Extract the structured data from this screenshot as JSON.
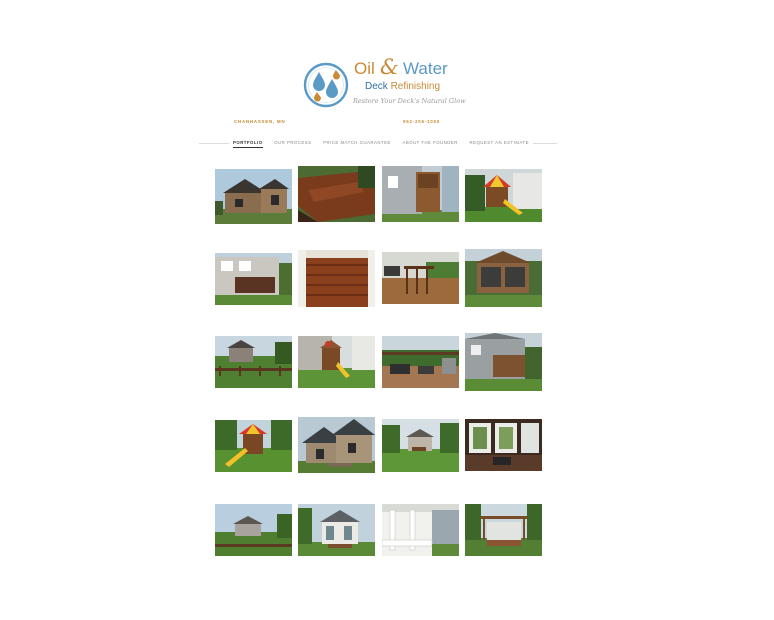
{
  "brand": {
    "oil": "Oil",
    "amp": "&",
    "water": "Water",
    "deck": "Deck",
    "refinishing": "Refinishing",
    "tagline": "Restore Your Deck's Natural Glow",
    "colors": {
      "gold": "#c98a35",
      "blue": "#5b9ac7",
      "dark_blue": "#2f6fa8"
    }
  },
  "header": {
    "location": "CHANHASSEN, MN",
    "phone": "952-206-1050"
  },
  "nav": {
    "items": [
      {
        "label": "PORTFOLIO",
        "active": true
      },
      {
        "label": "OUR PROCESS"
      },
      {
        "label": "PRICE MATCH GUARANTEE"
      },
      {
        "label": "ABOUT THE FOUNDER"
      },
      {
        "label": "REQUEST AN ESTIMATE"
      }
    ]
  },
  "gallery": {
    "rows": [
      [
        "house-exterior",
        "stained-deck",
        "deck-side-house",
        "playset"
      ],
      [
        "house-rear-deck",
        "deck-boards-closeup",
        "deck-railing-patio",
        "screened-porch"
      ],
      [
        "backyard-fence",
        "playset-yard",
        "patio-furniture",
        "deck-grey-house"
      ],
      [
        "playset-slide",
        "stone-house-front",
        "backyard-lawn",
        "sunroom-interior"
      ],
      [
        "backyard-distance",
        "gazebo-house",
        "porch-columns",
        "pergola-patio"
      ]
    ]
  }
}
